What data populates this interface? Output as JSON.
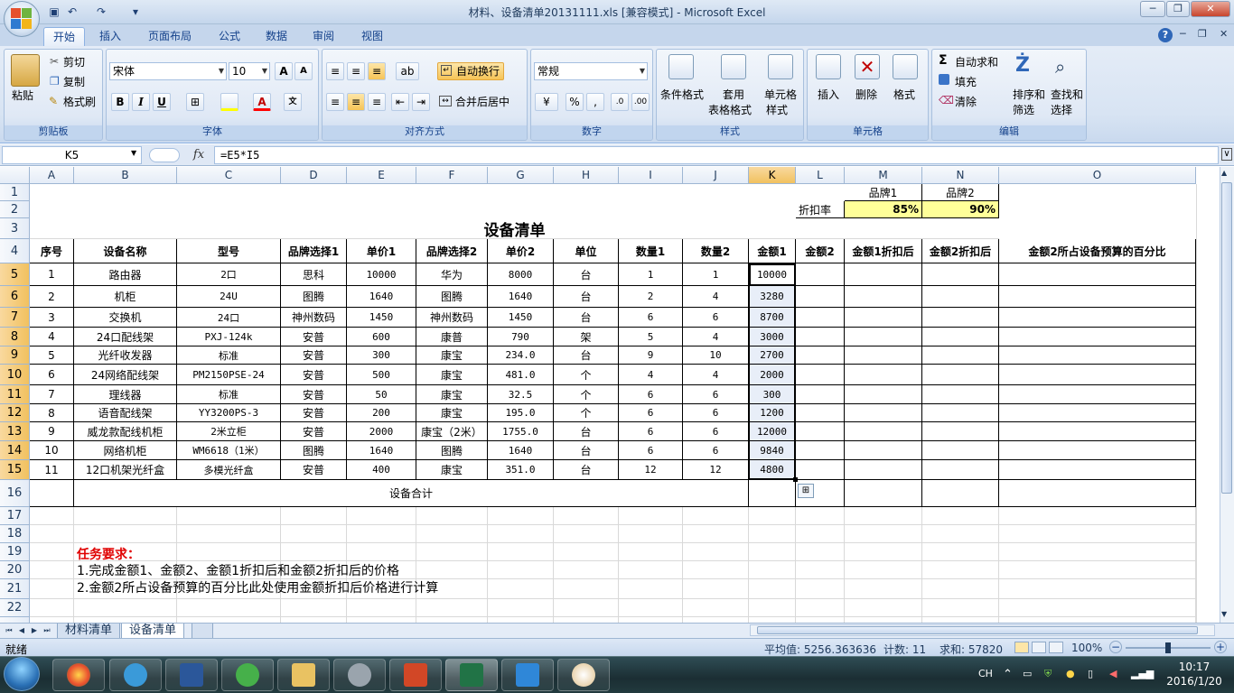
{
  "window": {
    "title": "材料、设备清单20131111.xls  [兼容模式] - Microsoft Excel"
  },
  "ribbon_tabs": [
    "开始",
    "插入",
    "页面布局",
    "公式",
    "数据",
    "审阅",
    "视图"
  ],
  "ribbon": {
    "clipboard": {
      "paste": "粘贴",
      "cut": "剪切",
      "copy": "复制",
      "format_painter": "格式刷",
      "label": "剪贴板"
    },
    "font": {
      "name": "宋体",
      "size": "10",
      "label": "字体"
    },
    "alignment": {
      "wrap": "自动换行",
      "merge": "合并后居中",
      "label": "对齐方式"
    },
    "number": {
      "format": "常规",
      "label": "数字"
    },
    "styles": {
      "conditional": "条件格式",
      "table_line1": "套用",
      "table_line2": "表格格式",
      "cell_line1": "单元格",
      "cell_line2": "样式",
      "label": "样式"
    },
    "cells": {
      "insert": "插入",
      "delete": "删除",
      "format": "格式",
      "label": "单元格"
    },
    "editing": {
      "autosum": "自动求和",
      "fill": "填充",
      "clear": "清除",
      "sort_line1": "排序和",
      "sort_line2": "筛选",
      "find_line1": "查找和",
      "find_line2": "选择",
      "label": "编辑"
    }
  },
  "formula_bar": {
    "name_box": "K5",
    "fx": "fx",
    "formula": "=E5*I5"
  },
  "columns": [
    "A",
    "B",
    "C",
    "D",
    "E",
    "F",
    "G",
    "H",
    "I",
    "J",
    "K",
    "L",
    "M",
    "N",
    "O"
  ],
  "row_numbers": [
    "1",
    "2",
    "3",
    "4",
    "5",
    "6",
    "7",
    "8",
    "9",
    "10",
    "11",
    "12",
    "13",
    "14",
    "15",
    "16",
    "17",
    "18",
    "19",
    "20",
    "21",
    "22",
    "24"
  ],
  "sheet": {
    "brand1": "品牌1",
    "brand2": "品牌2",
    "discount_label": "折扣率",
    "discount1": "85%",
    "discount2": "90%",
    "title": "设备清单",
    "headers": [
      "序号",
      "设备名称",
      "型号",
      "品牌选择1",
      "单价1",
      "品牌选择2",
      "单价2",
      "单位",
      "数量1",
      "数量2",
      "金额1",
      "金额2",
      "金额1折扣后",
      "金额2折扣后",
      "金额2所占设备预算的百分比"
    ],
    "rows": [
      [
        "1",
        "路由器",
        "2口",
        "思科",
        "10000",
        "华为",
        "8000",
        "台",
        "1",
        "1",
        "10000"
      ],
      [
        "2",
        "机柜",
        "24U",
        "图腾",
        "1640",
        "图腾",
        "1640",
        "台",
        "2",
        "4",
        "3280"
      ],
      [
        "3",
        "交换机",
        "24口",
        "神州数码",
        "1450",
        "神州数码",
        "1450",
        "台",
        "6",
        "6",
        "8700"
      ],
      [
        "4",
        "24口配线架",
        "PXJ-124k",
        "安普",
        "600",
        "康普",
        "790",
        "架",
        "5",
        "4",
        "3000"
      ],
      [
        "5",
        "光纤收发器",
        "标准",
        "安普",
        "300",
        "康宝",
        "234.0",
        "台",
        "9",
        "10",
        "2700"
      ],
      [
        "6",
        "24网络配线架",
        "PM2150PSE-24",
        "安普",
        "500",
        "康宝",
        "481.0",
        "个",
        "4",
        "4",
        "2000"
      ],
      [
        "7",
        "理线器",
        "标准",
        "安普",
        "50",
        "康宝",
        "32.5",
        "个",
        "6",
        "6",
        "300"
      ],
      [
        "8",
        "语音配线架",
        "YY3200PS-3",
        "安普",
        "200",
        "康宝",
        "195.0",
        "个",
        "6",
        "6",
        "1200"
      ],
      [
        "9",
        "威龙款配线机柜",
        "2米立柜",
        "安普",
        "2000",
        "康宝（2米）",
        "1755.0",
        "台",
        "6",
        "6",
        "12000"
      ],
      [
        "10",
        "网络机柜",
        "WM6618（1米）",
        "图腾",
        "1640",
        "图腾",
        "1640",
        "台",
        "6",
        "6",
        "9840"
      ],
      [
        "11",
        "12口机架光纤盒",
        "多模光纤盒",
        "安普",
        "400",
        "康宝",
        "351.0",
        "台",
        "12",
        "12",
        "4800"
      ]
    ],
    "total_label": "设备合计",
    "task_title": "任务要求：",
    "task_line1": "1.完成金额1、金额2、金额1折扣后和金额2折扣后的价格",
    "task_line2": "2.金额2所占设备预算的百分比此处使用金额折扣后价格进行计算"
  },
  "sheet_tabs": [
    "材料清单",
    "设备清单"
  ],
  "status": {
    "ready": "就绪",
    "average": "平均值: 5256.363636",
    "count": "计数: 11",
    "sum": "求和: 57820",
    "zoom": "100%"
  },
  "taskbar": {
    "lang": "CH",
    "time": "10:17",
    "date": "2016/1/20"
  }
}
